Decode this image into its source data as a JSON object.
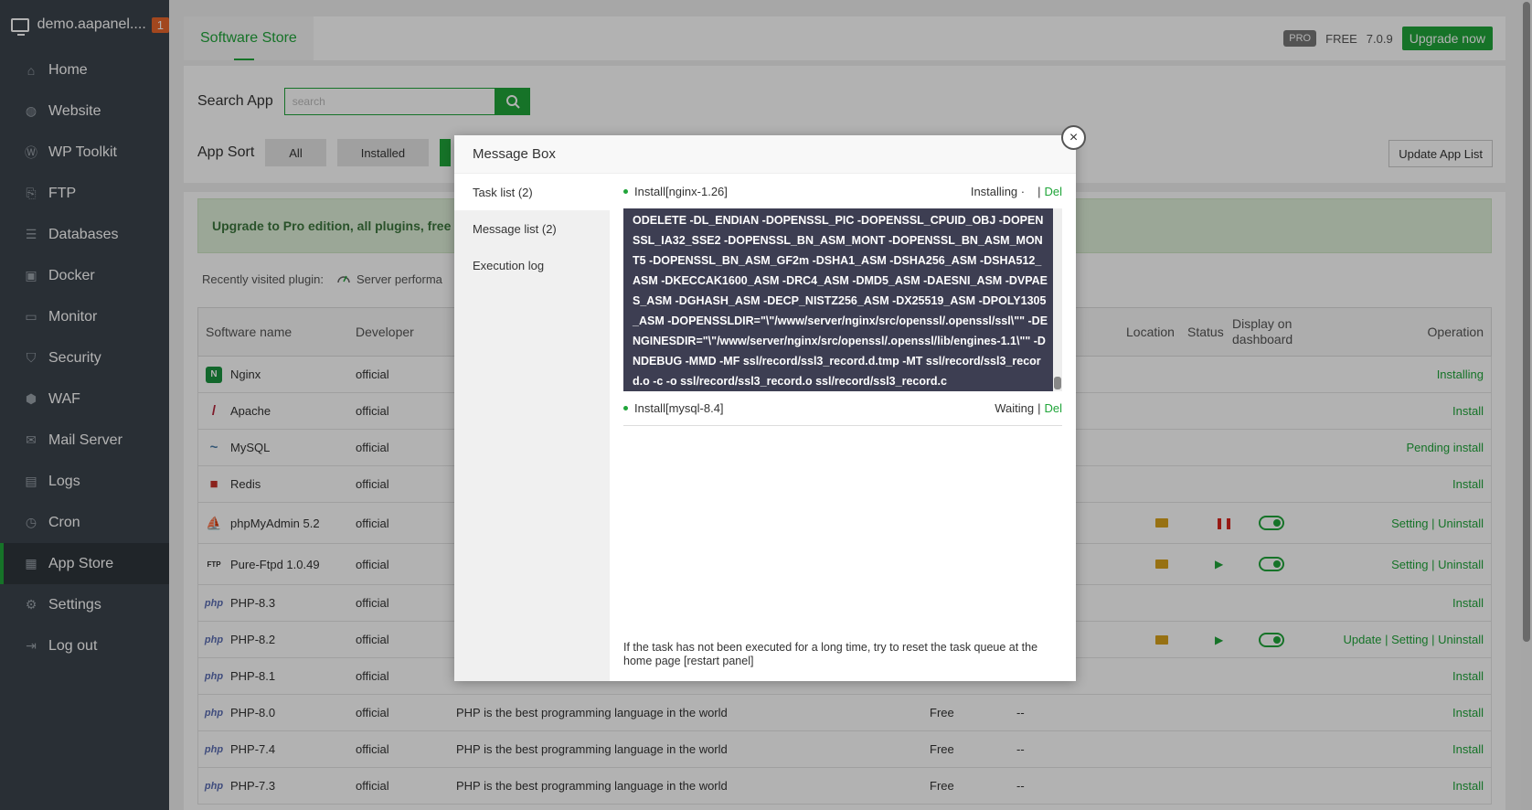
{
  "sidebar": {
    "brand": "demo.aapanel....",
    "badge": "1",
    "items": [
      {
        "label": "Home",
        "icon": "home-icon"
      },
      {
        "label": "Website",
        "icon": "globe-icon"
      },
      {
        "label": "WP Toolkit",
        "icon": "wordpress-icon"
      },
      {
        "label": "FTP",
        "icon": "ftp-icon"
      },
      {
        "label": "Databases",
        "icon": "database-icon"
      },
      {
        "label": "Docker",
        "icon": "docker-icon"
      },
      {
        "label": "Monitor",
        "icon": "monitor-icon"
      },
      {
        "label": "Security",
        "icon": "shield-icon"
      },
      {
        "label": "WAF",
        "icon": "waf-icon"
      },
      {
        "label": "Mail Server",
        "icon": "mail-icon"
      },
      {
        "label": "Logs",
        "icon": "logs-icon"
      },
      {
        "label": "Cron",
        "icon": "clock-icon"
      },
      {
        "label": "App Store",
        "icon": "grid-icon"
      },
      {
        "label": "Settings",
        "icon": "gear-icon"
      },
      {
        "label": "Log out",
        "icon": "logout-icon"
      }
    ]
  },
  "topbar": {
    "tab": "Software Store",
    "pro": "PRO",
    "free": "FREE",
    "version": "7.0.9",
    "upgrade": "Upgrade now"
  },
  "search": {
    "label": "Search App",
    "placeholder": "search"
  },
  "sort": {
    "label": "App Sort",
    "all": "All",
    "installed": "Installed",
    "update_list": "Update App List"
  },
  "banner": "Upgrade to Pro edition, all plugins, free t",
  "recent": {
    "label": "Recently visited plugin:",
    "item": "Server performa"
  },
  "table": {
    "headers": {
      "name": "Software name",
      "dev": "Developer",
      "loc": "Location",
      "status": "Status",
      "display": "Display on dashboard",
      "op": "Operation"
    },
    "rows": [
      {
        "name": "Nginx",
        "dev": "official",
        "op": "Installing"
      },
      {
        "name": "Apache",
        "dev": "official",
        "op": "Install"
      },
      {
        "name": "MySQL",
        "dev": "official",
        "op": "Pending install"
      },
      {
        "name": "Redis",
        "dev": "official",
        "op": "Install"
      },
      {
        "name": "phpMyAdmin 5.2",
        "dev": "official",
        "op": "Setting | Uninstall"
      },
      {
        "name": "Pure-Ftpd 1.0.49",
        "dev": "official",
        "op": "Setting | Uninstall"
      },
      {
        "name": "PHP-8.3",
        "dev": "official",
        "op": "Install"
      },
      {
        "name": "PHP-8.2",
        "dev": "official",
        "op": "Update | Setting | Uninstall"
      },
      {
        "name": "PHP-8.1",
        "dev": "official",
        "op": "Install"
      },
      {
        "name": "PHP-8.0",
        "dev": "official",
        "desc": "PHP is the best programming language in the world",
        "price": "Free",
        "expire": "--",
        "op": "Install"
      },
      {
        "name": "PHP-7.4",
        "dev": "official",
        "desc": "PHP is the best programming language in the world",
        "price": "Free",
        "expire": "--",
        "op": "Install"
      },
      {
        "name": "PHP-7.3",
        "dev": "official",
        "desc": "PHP is the best programming language in the world",
        "price": "Free",
        "expire": "--",
        "op": "Install"
      }
    ]
  },
  "modal": {
    "title": "Message Box",
    "tabs": [
      "Task list (2)",
      "Message list (2)",
      "Execution log"
    ],
    "task1": {
      "name": "Install[nginx-1.26]",
      "status": "Installing ·",
      "sep": "|",
      "del": "Del"
    },
    "log": "ODELETE -DL_ENDIAN -DOPENSSL_PIC -DOPENSSL_CPUID_OBJ -DOPENSSL_IA32_SSE2 -DOPENSSL_BN_ASM_MONT -DOPENSSL_BN_ASM_MONT5 -DOPENSSL_BN_ASM_GF2m -DSHA1_ASM -DSHA256_ASM -DSHA512_ASM -DKECCAK1600_ASM -DRC4_ASM -DMD5_ASM -DAESNI_ASM -DVPAES_ASM -DGHASH_ASM -DECP_NISTZ256_ASM -DX25519_ASM -DPOLY1305_ASM -DOPENSSLDIR=\"\\\"/www/server/nginx/src/openssl/.openssl/ssl\\\"\" -DENGINESDIR=\"\\\"/www/server/nginx/src/openssl/.openssl/lib/engines-1.1\\\"\" -DNDEBUG -MMD -MF ssl/record/ssl3_record.d.tmp -MT ssl/record/ssl3_record.o -c -o ssl/record/ssl3_record.o ssl/record/ssl3_record.c",
    "task2": {
      "name": "Install[mysql-8.4]",
      "status": "Waiting",
      "sep": "|",
      "del": "Del"
    },
    "hint": "If the task has not been executed for a long time, try to reset the task queue at the home page [restart panel]",
    "close": "×"
  }
}
